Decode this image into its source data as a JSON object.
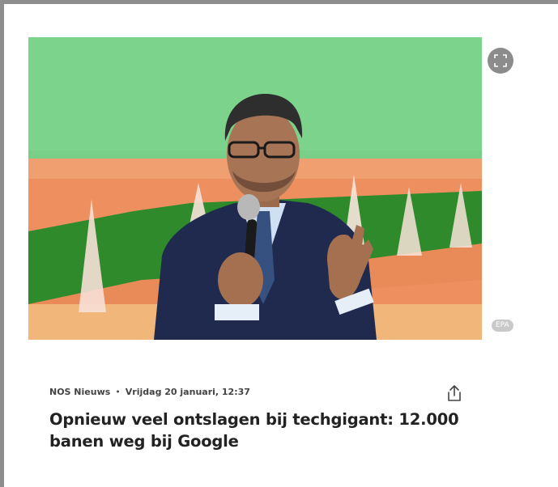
{
  "article": {
    "source": "NOS Nieuws",
    "separator": "•",
    "date": "Vrijdag 20 januari, 12:37",
    "headline": "Opnieuw veel ontslagen bij techgigant: 12.000 banen weg bij Google"
  },
  "photo": {
    "credit": "EPA"
  },
  "icons": {
    "expand": "expand-icon",
    "share": "share-icon"
  },
  "colors": {
    "headline": "#222222",
    "meta": "#555555",
    "expand_button": "#8c8c8c",
    "credit_badge": "#c9c9c9"
  }
}
